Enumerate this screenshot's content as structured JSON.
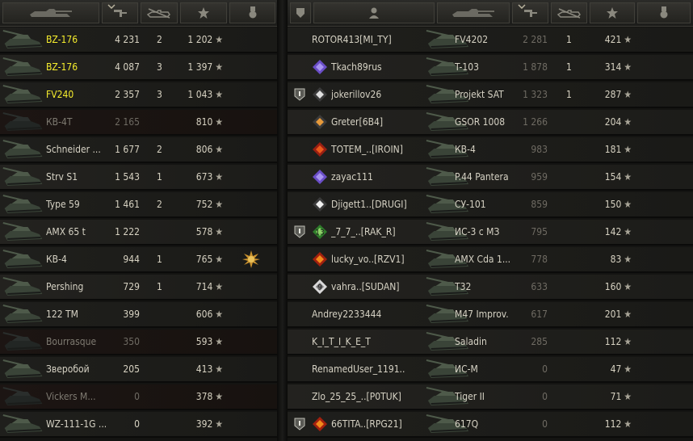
{
  "left_header": {
    "icons": [
      "tank-class-icon",
      "damage-icon",
      "kills-icon",
      "xp-star-icon",
      "medal-icon"
    ]
  },
  "right_header": {
    "icons": [
      "platoon-icon",
      "player-icon",
      "tank-class-icon",
      "damage-icon",
      "kills-icon",
      "xp-star-icon",
      "medal-icon"
    ]
  },
  "colors": {
    "highlight_name": "#f7ee2d",
    "normal_text": "#d6d2c4",
    "dead_text": "#7e7a71",
    "panel_bg": "#141412"
  },
  "left_team": [
    {
      "tank": "BZ-176",
      "damage": "4 231",
      "kills": "2",
      "xp": "1 202",
      "highlight": true
    },
    {
      "tank": "BZ-176",
      "damage": "4 087",
      "kills": "3",
      "xp": "1 397",
      "highlight": true
    },
    {
      "tank": "FV240",
      "damage": "2 357",
      "kills": "3",
      "xp": "1 043",
      "highlight": true
    },
    {
      "tank": "КВ-4Т",
      "damage": "2 165",
      "kills": "",
      "xp": "810",
      "dead": true
    },
    {
      "tank": "Schneider ...",
      "damage": "1 677",
      "kills": "2",
      "xp": "806"
    },
    {
      "tank": "Strv S1",
      "damage": "1 543",
      "kills": "1",
      "xp": "673"
    },
    {
      "tank": "Type 59",
      "damage": "1 461",
      "kills": "2",
      "xp": "752"
    },
    {
      "tank": "AMX 65 t",
      "damage": "1 222",
      "kills": "",
      "xp": "578"
    },
    {
      "tank": "КВ-4",
      "damage": "944",
      "kills": "1",
      "xp": "765",
      "medal": true
    },
    {
      "tank": "Pershing",
      "damage": "729",
      "kills": "1",
      "xp": "714"
    },
    {
      "tank": "122 TM",
      "damage": "399",
      "kills": "",
      "xp": "606"
    },
    {
      "tank": "Bourrasque",
      "damage": "350",
      "kills": "",
      "xp": "593",
      "dead": true
    },
    {
      "tank": "Зверобой",
      "damage": "205",
      "kills": "",
      "xp": "413"
    },
    {
      "tank": "Vickers M...",
      "damage": "0",
      "kills": "",
      "xp": "378",
      "dead": true
    },
    {
      "tank": "WZ-111-1G ...",
      "damage": "0",
      "kills": "",
      "xp": "392"
    }
  ],
  "right_team": [
    {
      "player": "ROTOR413[MI_TY]",
      "tank": "FV4202",
      "damage": "2 281",
      "kills": "1",
      "xp": "421",
      "platoon": false,
      "rank": ""
    },
    {
      "player": "Tkach89rus",
      "tank": "T-103",
      "damage": "1 878",
      "kills": "1",
      "xp": "314",
      "platoon": false,
      "rank": "purple"
    },
    {
      "player": "jokerillov26",
      "tank": "Projekt SAT",
      "damage": "1 323",
      "kills": "1",
      "xp": "287",
      "platoon": true,
      "rank": "diamond"
    },
    {
      "player": "Greter[6B4]",
      "tank": "GSOR 1008",
      "damage": "1 266",
      "kills": "",
      "xp": "204",
      "platoon": false,
      "rank": "diamond-orange"
    },
    {
      "player": "TOTEM_..[IROIN]",
      "tank": "КВ-4",
      "damage": "983",
      "kills": "",
      "xp": "181",
      "platoon": false,
      "rank": "red"
    },
    {
      "player": "zayac111",
      "tank": "P.44 Pantera",
      "damage": "959",
      "kills": "",
      "xp": "154",
      "platoon": false,
      "rank": "purple"
    },
    {
      "player": "Djigett1..[DRUGI]",
      "tank": "СУ-101",
      "damage": "859",
      "kills": "",
      "xp": "150",
      "platoon": false,
      "rank": "diamond-white"
    },
    {
      "player": "_7_7_..[RAK_R]",
      "tank": "ИС-3 с МЗ",
      "damage": "795",
      "kills": "",
      "xp": "142",
      "platoon": true,
      "rank": "green",
      "rank_label": "13"
    },
    {
      "player": "lucky_vo..[RZV1]",
      "tank": "AMX Cda 1...",
      "damage": "778",
      "kills": "",
      "xp": "83",
      "platoon": false,
      "rank": "red-orange"
    },
    {
      "player": "vahra..[SUDAN]",
      "tank": "T32",
      "damage": "633",
      "kills": "",
      "xp": "160",
      "platoon": false,
      "rank": "white",
      "rank_label": "9"
    },
    {
      "player": "Andrey2233444",
      "tank": "M47 Improv.",
      "damage": "617",
      "kills": "",
      "xp": "201",
      "platoon": false,
      "rank": ""
    },
    {
      "player": "K_I_T_I_K_E_T",
      "tank": "Saladin",
      "damage": "285",
      "kills": "",
      "xp": "112",
      "platoon": false,
      "rank": ""
    },
    {
      "player": "RenamedUser_1191..",
      "tank": "ИС-М",
      "damage": "0",
      "kills": "",
      "xp": "47",
      "platoon": false,
      "rank": ""
    },
    {
      "player": "Zlo_25_25_..[P0TUK]",
      "tank": "Tiger II",
      "damage": "0",
      "kills": "",
      "xp": "71",
      "platoon": false,
      "rank": ""
    },
    {
      "player": "66TITA..[RPG21]",
      "tank": "617Q",
      "damage": "0",
      "kills": "",
      "xp": "112",
      "platoon": true,
      "rank": "red-orange"
    }
  ],
  "star_glyph": "★"
}
